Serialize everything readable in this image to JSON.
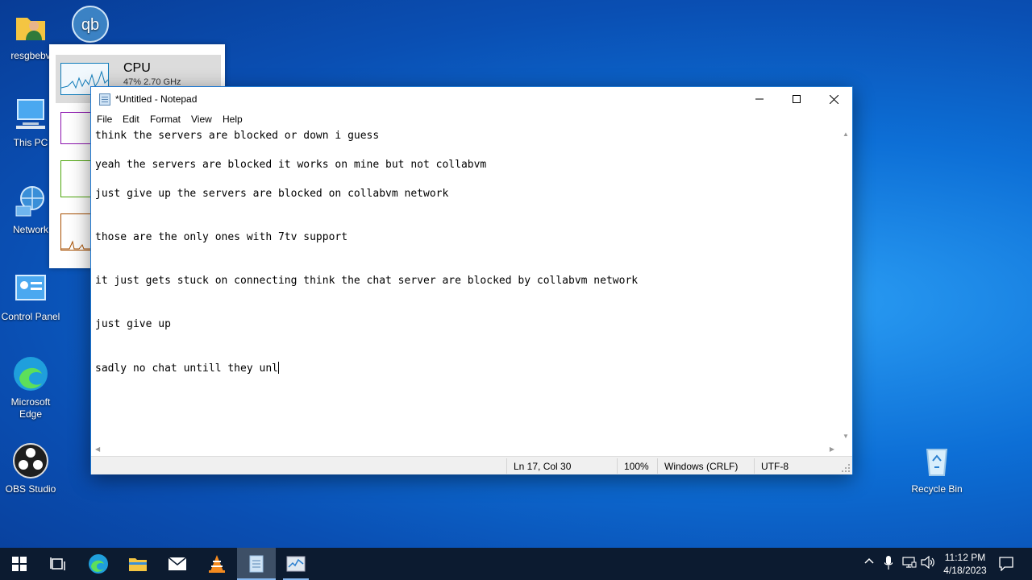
{
  "desktop": {
    "icons": [
      {
        "label": "resgbebv",
        "icon": "user-folder-icon"
      },
      {
        "label": "qb",
        "icon": "qbittorrent-icon"
      },
      {
        "label": "This PC",
        "icon": "computer-icon"
      },
      {
        "label": "Network",
        "icon": "network-icon"
      },
      {
        "label": "Control Panel",
        "icon": "control-panel-icon"
      },
      {
        "label": "Microsoft Edge",
        "icon": "edge-icon"
      },
      {
        "label": "OBS Studio",
        "icon": "obs-icon"
      },
      {
        "label": "Recycle Bin",
        "icon": "recycle-bin-icon"
      }
    ]
  },
  "taskmanager": {
    "cpu_title": "CPU",
    "cpu_sub": "47%  2.70 GHz"
  },
  "notepad": {
    "title": "*Untitled - Notepad",
    "menu": [
      "File",
      "Edit",
      "Format",
      "View",
      "Help"
    ],
    "lines": [
      "think the servers are blocked or down i guess",
      "yeah the servers are blocked it works on mine but not collabvm",
      "just give up the servers are blocked on collabvm network",
      "those are the only ones with 7tv support",
      "it just gets stuck on connecting think the chat server are blocked by collabvm network",
      "just give up",
      "sadly no chat untill they unl"
    ],
    "status": {
      "position": "Ln 17, Col 30",
      "zoom": "100%",
      "line_ending": "Windows (CRLF)",
      "encoding": "UTF-8"
    }
  },
  "taskbar": {
    "time": "11:12 PM",
    "date": "4/18/2023",
    "apps": [
      "start-icon",
      "task-view-icon",
      "edge-icon",
      "file-explorer-icon",
      "mail-icon",
      "vlc-icon",
      "notepad-icon",
      "task-manager-icon"
    ]
  },
  "colors": {
    "accent": "#0a6fd6",
    "taskbar": "#0c1b30",
    "notepad_border": "#1f78d0"
  }
}
